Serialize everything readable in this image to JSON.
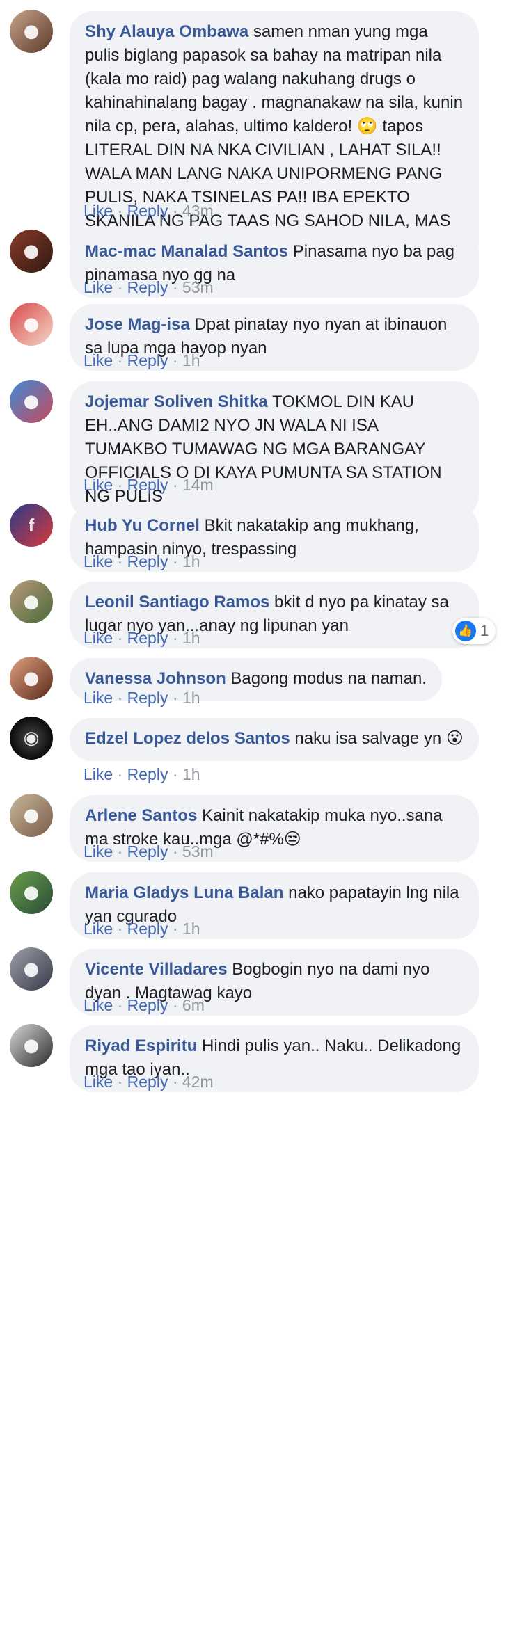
{
  "colors": {
    "name": "#385898",
    "link": "#4267b2",
    "meta": "#90949c",
    "bubble": "#f0f2f5",
    "like_badge": "#1877f2"
  },
  "actions": {
    "like": "Like",
    "reply": "Reply",
    "separator": "·"
  },
  "comments": [
    {
      "avatar_icon": "user-photo-avatar",
      "name": "Shy Alauya Ombawa",
      "text": "samen nman yung mga pulis biglang papasok sa bahay na matripan nila (kala mo raid) pag walang nakuhang drugs o kahinahinalang bagay . magnanakaw na sila, kunin nila cp, pera, alahas, ultimo kaldero! 🙄 tapos LITERAL DIN NA NKA CIVILIAN , LAHAT SILA!! WALA MAN LANG NAKA UNIPORMENG PANG PULIS, NAKA TSINELAS PA!! IBA EPEKTO SKANILA NG PAG TAAS NG SAHOD NILA, MAS LALO SILA NAGING GAHAMAN!! 😒😒",
      "time": "43m"
    },
    {
      "avatar_icon": "user-photo-avatar",
      "name": "Mac-mac Manalad Santos",
      "text": "Pinasama nyo ba pag pinamasa nyo gg na",
      "time": "53m"
    },
    {
      "avatar_icon": "user-photo-avatar",
      "name": "Jose Mag-isa",
      "text": "Dpat pinatay nyo nyan at ibinauon sa lupa mga hayop nyan",
      "time": "1h"
    },
    {
      "avatar_icon": "user-photo-avatar",
      "name": "Jojemar Soliven Shitka",
      "text": "TOKMOL DIN KAU EH..ANG DAMI2 NYO JN WALA NI ISA TUMAKBO TUMAWAG NG MGA BARANGAY OFFICIALS O DI KAYA PUMUNTA SA STATION NG PULIS",
      "time": "14m"
    },
    {
      "avatar_icon": "facebook-logo-avatar",
      "name": "Hub Yu Cornel",
      "text": "Bkit nakatakip ang mukhang, hampasin ninyo, trespassing",
      "time": "1h"
    },
    {
      "avatar_icon": "user-photo-avatar",
      "name": "Leonil Santiago Ramos",
      "text": "bkit d nyo pa kinatay sa lugar nyo yan...anay ng lipunan yan",
      "time": "1h",
      "reaction_count": "1"
    },
    {
      "avatar_icon": "user-photo-avatar",
      "name": "Vanessa Johnson",
      "text": "Bagong modus na naman.",
      "time": "1h"
    },
    {
      "avatar_icon": "user-photo-avatar",
      "name": "Edzel Lopez delos Santos",
      "text": "naku isa salvage yn 😮",
      "time": "1h"
    },
    {
      "avatar_icon": "user-photo-avatar",
      "name": "Arlene Santos",
      "text": "Kainit nakatakip muka nyo..sana ma stroke kau..mga @*#%😒",
      "time": "53m"
    },
    {
      "avatar_icon": "user-photo-avatar",
      "name": "Maria Gladys Luna Balan",
      "text": "nako papatayin lng nila yan cgurado",
      "time": "1h"
    },
    {
      "avatar_icon": "user-photo-avatar",
      "name": "Vicente Villadares",
      "text": "Bogbogin nyo na dami nyo dyan . Magtawag kayo",
      "time": "6m"
    },
    {
      "avatar_icon": "user-photo-avatar",
      "name": "Riyad Espiritu",
      "text": "Hindi pulis yan.. Naku.. Delikadong mga tao iyan..",
      "time": "42m"
    }
  ]
}
